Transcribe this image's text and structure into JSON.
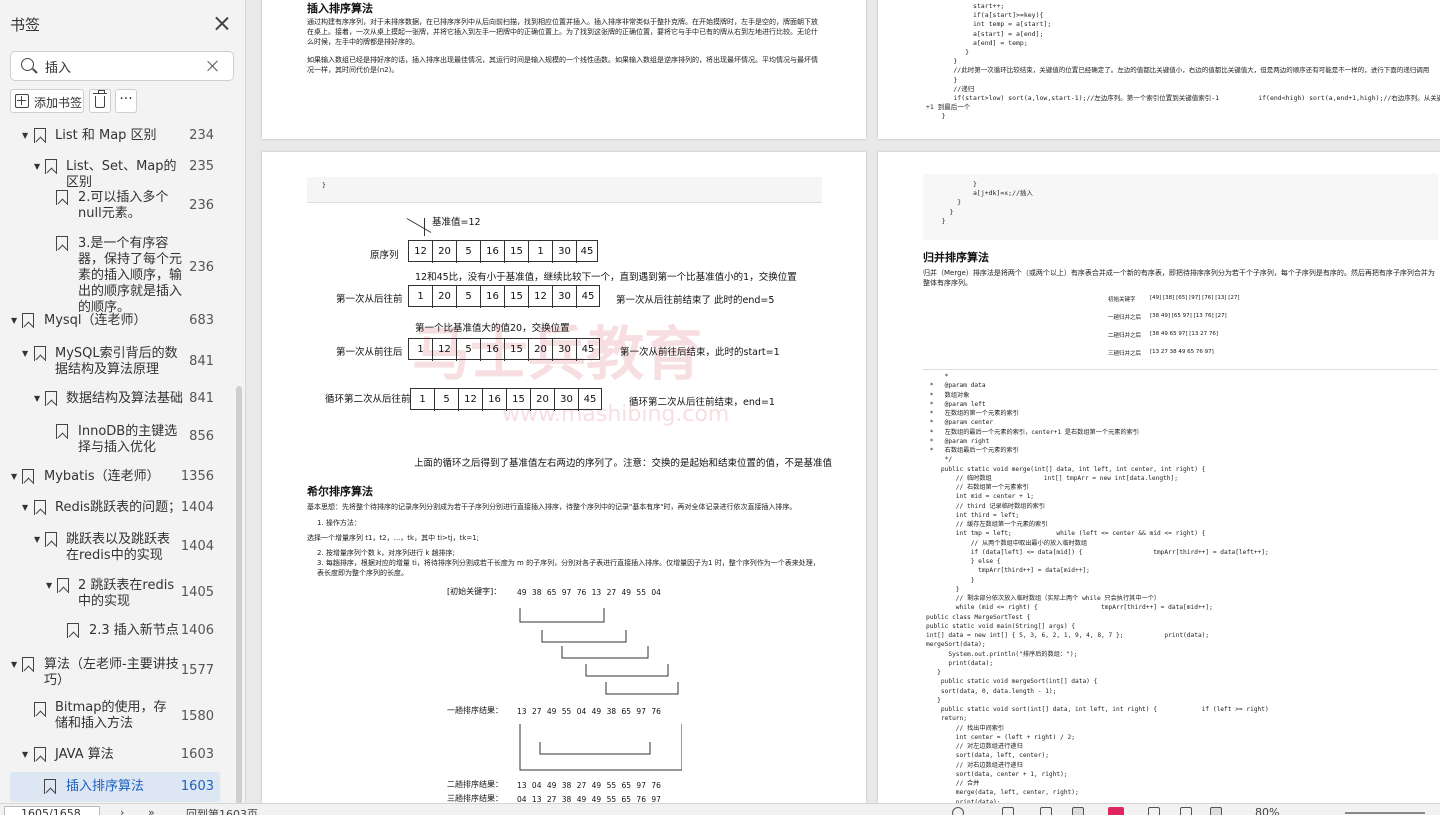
{
  "sidebar": {
    "title": "书签",
    "search_value": "插入",
    "add_bookmark": "添加书签",
    "more": "···",
    "items": [
      {
        "label": "List 和 Map 区别",
        "page": "234"
      },
      {
        "label": "List、Set、Map的区别",
        "page": "235"
      },
      {
        "label": "2.可以插入多个null元素。",
        "page": "236"
      },
      {
        "label": "3.是一个有序容器，保持了每个元素的插入顺序，输出的顺序就是插入的顺序。",
        "page": "236"
      },
      {
        "label": "Mysql（连老师）",
        "page": "683"
      },
      {
        "label": "MySQL索引背后的数据结构及算法原理",
        "page": "841"
      },
      {
        "label": "数据结构及算法基础",
        "page": "841"
      },
      {
        "label": "InnoDB的主键选择与插入优化",
        "page": "856"
      },
      {
        "label": "Mybatis（连老师）",
        "page": "1356"
      },
      {
        "label": "Redis跳跃表的问题；",
        "page": "1404"
      },
      {
        "label": "跳跃表以及跳跃表在redis中的实现",
        "page": "1404"
      },
      {
        "label": "2 跳跃表在redis中的实现",
        "page": "1405"
      },
      {
        "label": "2.3 插入新节点",
        "page": "1406"
      },
      {
        "label": "算法（左老师-主要讲技巧）",
        "page": "1577"
      },
      {
        "label": "Bitmap的使用，存储和插入方法",
        "page": "1580"
      },
      {
        "label": "JAVA 算法",
        "page": "1603"
      },
      {
        "label": "插入排序算法",
        "page": "1603"
      }
    ]
  },
  "doc": {
    "insert_sort_title": "插入排序算法",
    "insert_sort_p1": "通过构建有序序列，对于未排序数据，在已排序序列中从后向前扫描，找到相应位置并插入。插入排序非常类似于整扑克牌。在开始摸牌时，左手是空的，牌面朝下放在桌上。接着，一次从桌上摸起一张牌，并将它插入到左手一把牌中的正确位置上。为了找到这张牌的正确位置，要将它与手中已有的牌从右到左地进行比较。无论什么时候，左手中的牌都是排好序的。",
    "insert_sort_p2": "如果输入数组已经是排好序的话，插入排序出现最佳情况，其运行时间是输入规模的一个线性函数。如果输入数组是逆序排列的，将出现最坏情况。平均情况与最坏情况一样，其时间代价是(n2)。",
    "pivot_label": "基准值=12",
    "row_labels": [
      "原序列",
      "第一次从后往前",
      "第一次从前往后",
      "循环第二次从后往前"
    ],
    "rows": [
      [
        "12",
        "20",
        "5",
        "16",
        "15",
        "1",
        "30",
        "45"
      ],
      [
        "1",
        "20",
        "5",
        "16",
        "15",
        "12",
        "30",
        "45"
      ],
      [
        "1",
        "12",
        "5",
        "16",
        "15",
        "20",
        "30",
        "45"
      ],
      [
        "1",
        "5",
        "12",
        "16",
        "15",
        "20",
        "30",
        "45"
      ]
    ],
    "note1": "12和45比，没有小于基准值，继续比较下一个，直到遇到第一个比基准值小的1，交换位置",
    "note2": "第一次从后往前结束了    此时的end=5",
    "note3": "第一个比基准值大的值20，交换位置",
    "note4": "第一次从前往后结束，此时的start=1",
    "note5": "循环第二次从后往前结束，end=1",
    "note6": "上面的循环之后得到了基准值左右两边的序列了。注意：交换的是起始和结束位置的值，不是基准值",
    "shell_title": "希尔排序算法",
    "shell_p1": "基本思想：先将整个待排序的记录序列分割成为若干子序列分别进行直接插入排序，待整个序列中的记录\"基本有序\"时，再对全体记录进行依次直接插入排序。",
    "shell_step": "1. 操作方法：",
    "shell_p2": "选择一个增量序列 t1，t2，...，tk，其中 ti>tj，tk=1;",
    "shell_p3": "2. 按增量序列个数 k，对序列进行 k 趟排序;",
    "shell_p4": "3. 每趟排序，根据对应的增量 ti，将待排序列分割成若干长度为 m 的子序列，分别对各子表进行直接插入排序。仅增量因子为1 时，整个序列作为一个表来处理，表长度即为整个序列的长度。",
    "shell_init": "[初始关键字]：",
    "shell_init_row": "49  38  65  97  76  13  27  49  55  04",
    "shell_pass1": "一趟排序结果：",
    "shell_pass1_row": "13  27  49  55  04  49  38  65  97  76",
    "shell_pass2": "二趟排序结果：",
    "shell_pass2_row": "13  04  49  38  27  49  55  65  97  76",
    "shell_pass3": "三趟排序结果：",
    "shell_pass3_row": "04  13  27  38  49  49  55  65  76  97",
    "watermark": "马士兵教育",
    "watermark_url": "www.mashibing.com",
    "merge_title": "归并排序算法",
    "merge_p1": "归并（Merge）排序法是将两个（或两个以上）有序表合并成一个新的有序表，即把待排序序列分为若干个子序列，每个子序列是有序的。然后再把有序子序列合并为整体有序序列。",
    "merge_rows": [
      {
        "label": "初始关键字",
        "vals": "[49]  [38]  [65]  [97]  [76]  [13]  [27]"
      },
      {
        "label": "一趟归并之后",
        "vals": "[38  49]  [65  97]  [13  76]  [27]"
      },
      {
        "label": "二趟归并之后",
        "vals": "[38  49  65  97]  [13  27  76]"
      },
      {
        "label": "三趟归并之后",
        "vals": "[13  27  38  49  65  76  97]"
      }
    ],
    "code_top_right": "            start++;\n            if(a[start]>=key){\n            int temp = a[start];\n            a[start] = a[end];\n            a[end] = temp;\n          }\n       }\n       //此时第一次循环比较结束，关键值的位置已经确定了。左边的值都比关键值小，右边的值都比关键值大，但是两边的顺序还有可能是不一样的，进行下面的递归调用\n       }\n       //递归\n       if(start>low) sort(a,low,start-1);//左边序列。第一个索引位置到关键值索引-1          if(end<high) sort(a,end+1,high);//右边序列。从关键值索引\n+1 到最后一个\n    }",
    "code_mid_right": "            }\n            a[j+dk]=x;//插入\n        }\n      }\n    }",
    "code_merge": "     *\n *   @param data\n *   数组对象\n *   @param left\n *   左数组的第一个元素的索引\n *   @param center\n *   左数组的最后一个元素的索引，center+1 是右数组第一个元素的索引\n *   @param right\n *   右数组最后一个元素的索引\n     */\n    public static void merge(int[] data, int left, int center, int right) {\n        // 临时数组              int[] tmpArr = new int[data.length];\n        // 右数组第一个元素索引\n        int mid = center + 1;\n        // third 记录临时数组的索引\n        int third = left;\n        // 缓存左数组第一个元素的索引\n        int tmp = left;            while (left <= center && mid <= right) {\n            // 从两个数组中取出最小的放入临时数组\n            if (data[left] <= data[mid]) {                   tmpArr[third++] = data[left++];\n            } else {\n              tmpArr[third++] = data[mid++];\n            }\n        }\n        // 剩余部分依次放入临时数组（实际上两个 while 只会执行其中一个）\n        while (mid <= right) {                 tmpArr[third++] = data[mid++];\npublic class MergeSortTest {\npublic static void main(String[] args) {\nint[] data = new int[] { 5, 3, 6, 2, 1, 9, 4, 8, 7 };           print(data);\nmergeSort(data);\n      System.out.println(\"排序后的数组：\");\n      print(data);\n   }\n    public static void mergeSort(int[] data) {\n    sort(data, 0, data.length - 1);\n   }\n    public static void sort(int[] data, int left, int right) {            if (left >= right)\n    return;\n        // 找出中间索引\n        int center = (left + right) / 2;\n        // 对左边数组进行递归\n        sort(data, left, center);\n        // 对右边数组进行递归\n        sort(data, center + 1, right);\n        // 合并\n        merge(data, left, center, right);\n        print(data);"
  },
  "status": {
    "page_input": "1605/1658",
    "back_text": "回到第1603页",
    "zoom": "80%"
  }
}
